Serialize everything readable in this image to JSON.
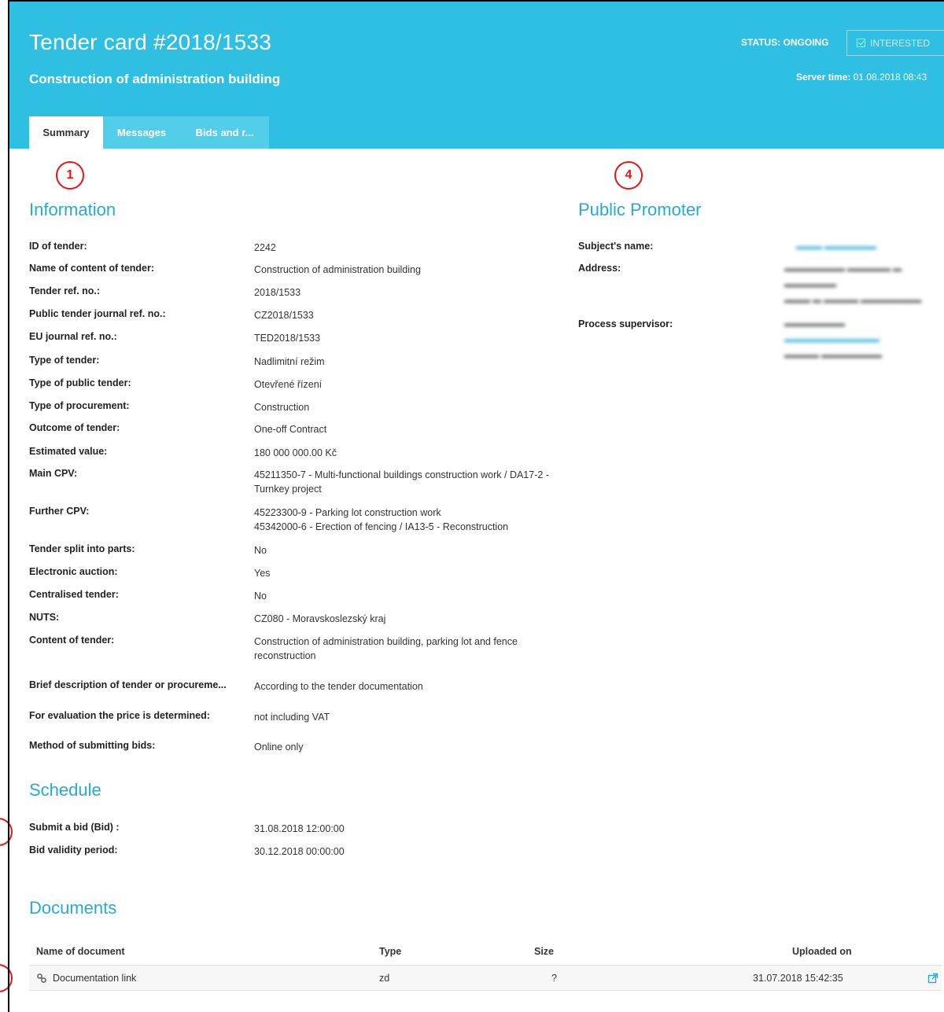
{
  "header": {
    "title": "Tender card #2018/1533",
    "subtitle": "Construction of administration building",
    "status": "STATUS: ONGOING",
    "interested_label": "INTERESTED",
    "server_time_label": "Server time:",
    "server_time_value": "01.08.2018 08:43"
  },
  "tabs": [
    {
      "label": "Summary"
    },
    {
      "label": "Messages"
    },
    {
      "label": "Bids and r..."
    }
  ],
  "markers": [
    "1",
    "4"
  ],
  "information": {
    "title": "Information",
    "rows": [
      {
        "label": "ID of tender:",
        "value": "2242"
      },
      {
        "label": "Name of content of tender:",
        "value": "Construction of administration building"
      },
      {
        "label": "Tender ref. no.:",
        "value": "2018/1533"
      },
      {
        "label": "Public tender journal ref. no.:",
        "value": "CZ2018/1533"
      },
      {
        "label": "EU journal ref. no.:",
        "value": "TED2018/1533"
      },
      {
        "label": "Type of tender:",
        "value": "Nadlimitní režim"
      },
      {
        "label": "Type of public tender:",
        "value": "Otevřené řízení"
      },
      {
        "label": "Type of procurement:",
        "value": "Construction"
      },
      {
        "label": "Outcome of tender:",
        "value": "One-off Contract"
      },
      {
        "label": "Estimated value:",
        "value": "180 000 000.00 Kč"
      },
      {
        "label": "Main CPV:",
        "value": "45211350-7 - Multi-functional buildings construction work / DA17-2 - Turnkey project"
      },
      {
        "label": "Further CPV:",
        "value": "45223300-9 - Parking lot construction work",
        "value2": "45342000-6 - Erection of fencing / IA13-5 - Reconstruction"
      },
      {
        "label": "Tender split into parts:",
        "value": "No"
      },
      {
        "label": "Electronic auction:",
        "value": "Yes"
      },
      {
        "label": "Centralised tender:",
        "value": "No"
      },
      {
        "label": "NUTS:",
        "value": "CZ080 - Moravskoslezský kraj"
      },
      {
        "label": "Content of tender:",
        "value": "Construction of administration building, parking lot and fence reconstruction"
      },
      {
        "label": "Brief description of tender or procureme...",
        "value": "According to the tender documentation"
      },
      {
        "label": "For evaluation the price is determined:",
        "value": "not including VAT"
      },
      {
        "label": "Method of submitting bids:",
        "value": "Online only"
      }
    ]
  },
  "promoter": {
    "title": "Public Promoter",
    "subject_label": "Subject's name:",
    "address_label": "Address:",
    "supervisor_label": "Process supervisor:"
  },
  "schedule": {
    "title": "Schedule",
    "rows": [
      {
        "label": "Submit a bid (Bid) :",
        "value": "31.08.2018 12:00:00"
      },
      {
        "label": "Bid validity period:",
        "value": "30.12.2018 00:00:00"
      }
    ]
  },
  "documents": {
    "title": "Documents",
    "columns": {
      "name": "Name of document",
      "type": "Type",
      "size": "Size",
      "uploaded": "Uploaded on"
    },
    "rows": [
      {
        "name": "Documentation link",
        "type": "zd",
        "size": "?",
        "uploaded": "31.07.2018 15:42:35"
      }
    ]
  },
  "colors": {
    "header_bg": "#2ebfe3",
    "accent": "#27a9d7",
    "marker": "#ee1111"
  }
}
